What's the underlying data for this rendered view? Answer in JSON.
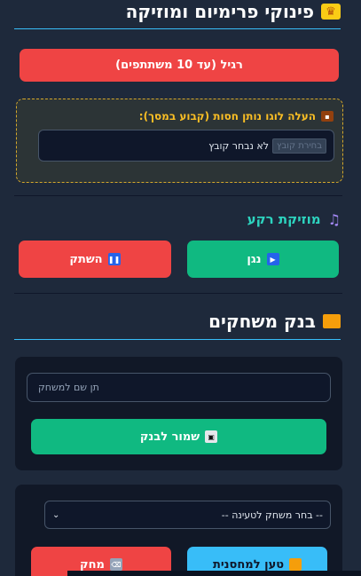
{
  "premium": {
    "title": "פינוקי פרימיום ומוזיקה",
    "crown_icon": "crown-icon",
    "plan_button": "רגיל (עד 10 משתתפים)",
    "upload_label": "העלה לוגו נותן חסות (קבוע במסך):",
    "briefcase_icon": "briefcase-icon",
    "file_button": "בחירת קובץ",
    "file_status": "לא נבחר קובץ"
  },
  "music": {
    "title": "מוזיקת רקע",
    "music_icon": "music-note-icon",
    "play_label": "נגן",
    "play_icon": "play-icon",
    "mute_label": "השתק",
    "pause_icon": "pause-icon"
  },
  "bank": {
    "title": "בנק משחקים",
    "folder_icon": "folder-icon",
    "name_placeholder": "תן שם למשחק",
    "save_label": "שמור לבנק",
    "save_icon": "floppy-disk-icon",
    "select_value": "-- בחר משחק לטעינה --",
    "load_label": "טען למחסנית",
    "delete_label": "מחק",
    "trash_icon": "trash-icon"
  },
  "colors": {
    "background": "#1e293b",
    "red": "#ef4444",
    "green": "#10b981",
    "blue": "#38bdf8",
    "teal": "#2dd4bf",
    "gold": "#fbbf24"
  }
}
